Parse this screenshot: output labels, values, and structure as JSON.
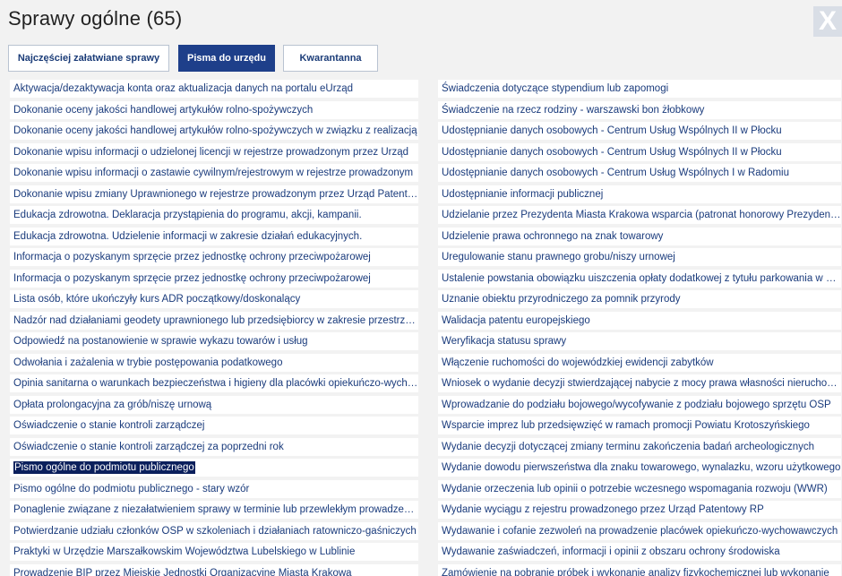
{
  "dialog": {
    "title": "Sprawy ogólne (65)",
    "close_label": "X"
  },
  "tabs": [
    {
      "label": "Najczęściej załatwiane sprawy",
      "active": false
    },
    {
      "label": "Pisma do urzędu",
      "active": true
    },
    {
      "label": "Kwarantanna",
      "active": false
    }
  ],
  "left_items": [
    "Aktywacja/dezaktywacja konta oraz aktualizacja danych na portalu eUrząd",
    "Dokonanie oceny jakości handlowej artykułów rolno-spożywczych",
    "Dokonanie oceny jakości handlowej artykułów rolno-spożywczych w związku z realizacją",
    "Dokonanie wpisu informacji o udzielonej licencji w rejestrze prowadzonym przez Urząd",
    "Dokonanie wpisu informacji o zastawie cywilnym/rejestrowym w rejestrze prowadzonym",
    "Dokonanie wpisu zmiany Uprawnionego w rejestrze prowadzonym przez Urząd Patentowy",
    "Edukacja zdrowotna. Deklaracja przystąpienia do programu, akcji, kampanii.",
    "Edukacja zdrowotna. Udzielenie informacji w zakresie działań edukacyjnych.",
    "Informacja o pozyskanym sprzęcie przez jednostkę ochrony przeciwpożarowej",
    "Informacja o pozyskanym sprzęcie przez jednostkę ochrony przeciwpożarowej",
    "Lista osób, które ukończyły kurs ADR początkowy/doskonalący",
    "Nadzór nad działaniami geodety uprawnionego lub przedsiębiorcy w zakresie przestrzegania",
    "Odpowiedź na postanowienie w sprawie wykazu towarów i usług",
    "Odwołania i zażalenia w trybie postępowania podatkowego",
    "Opinia sanitarna o warunkach bezpieczeństwa i higieny dla placówki opiekuńczo-wychowawczej",
    "Opłata prolongacyjna za grób/niszę urnową",
    "Oświadczenie o stanie kontroli zarządczej",
    "Oświadczenie o stanie kontroli zarządczej za poprzedni rok",
    "Pismo ogólne do podmiotu publicznego",
    "Pismo ogólne do podmiotu publicznego - stary wzór",
    "Ponaglenie związane z niezałatwieniem sprawy w terminie lub przewlekłym prowadzeniem",
    "Potwierdzanie udziału członków OSP w szkoleniach i działaniach ratowniczo-gaśniczych",
    "Praktyki w Urzędzie Marszałkowskim Województwa Lubelskiego w Lublinie",
    "Prowadzenie BIP przez Miejskie Jednostki Organizacyjne Miasta Krakowa"
  ],
  "selected_left_index": 18,
  "right_items": [
    "Świadczenia dotyczące stypendium lub zapomogi",
    "Świadczenie na rzecz rodziny - warszawski bon żłobkowy",
    "Udostępnianie danych osobowych - Centrum Usług Wspólnych II w Płocku",
    "Udostępnianie danych osobowych - Centrum Usług Wspólnych II w Płocku",
    "Udostępnianie danych osobowych - Centrum Usług Wspólnych I w Radomiu",
    "Udostępnianie informacji publicznej",
    "Udzielanie przez Prezydenta Miasta Krakowa wsparcia (patronat honorowy Prezydenta)",
    "Udzielenie prawa ochronnego na znak towarowy",
    "Uregulowanie stanu prawnego grobu/niszy urnowej",
    "Ustalenie powstania obowiązku uiszczenia opłaty dodatkowej z tytułu parkowania w Strefie",
    "Uznanie obiektu przyrodniczego za pomnik przyrody",
    "Walidacja patentu europejskiego",
    "Weryfikacja statusu sprawy",
    "Włączenie ruchomości do wojewódzkiej ewidencji zabytków",
    "Wniosek o wydanie decyzji stwierdzającej nabycie z mocy prawa własności nieruchomości",
    "Wprowadzanie do podziału bojowego/wycofywanie z podziału bojowego sprzętu OSP",
    "Wsparcie imprez lub przedsięwzięć w ramach promocji Powiatu Krotoszyńskiego",
    "Wydanie decyzji dotyczącej zmiany terminu zakończenia badań archeologicznych",
    "Wydanie dowodu pierwszeństwa dla znaku towarowego, wynalazku, wzoru użytkowego",
    "Wydanie orzeczenia lub opinii o potrzebie wczesnego wspomagania rozwoju (WWR)",
    "Wydanie wyciągu z rejestru prowadzonego przez Urząd Patentowy RP",
    "Wydawanie i cofanie zezwoleń na prowadzenie placówek opiekuńczo-wychowawczych",
    "Wydawanie zaświadczeń, informacji i opinii z obszaru ochrony środowiska",
    "Zamówienie na pobranie próbek i wykonanie analizy fizykochemicznej lub wykonanie"
  ]
}
